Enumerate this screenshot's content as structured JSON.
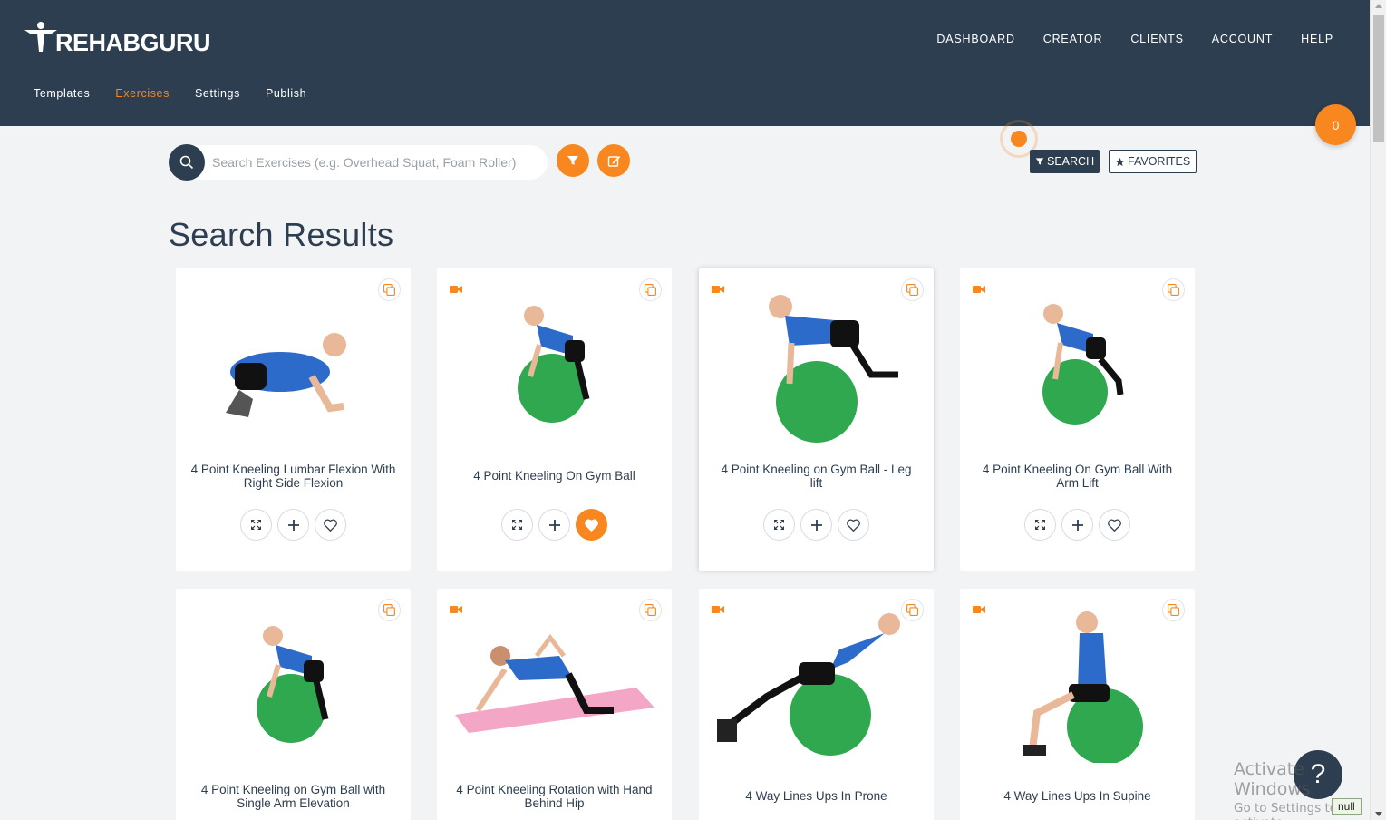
{
  "brand": {
    "name": "REHABGURU",
    "accent": "#f7871e",
    "header_bg": "#2d3e50"
  },
  "topnav": [
    {
      "label": "DASHBOARD"
    },
    {
      "label": "CREATOR"
    },
    {
      "label": "CLIENTS"
    },
    {
      "label": "ACCOUNT"
    },
    {
      "label": "HELP"
    }
  ],
  "subnav": [
    {
      "label": "Templates",
      "active": false
    },
    {
      "label": "Exercises",
      "active": true
    },
    {
      "label": "Settings",
      "active": false
    },
    {
      "label": "Publish",
      "active": false
    }
  ],
  "cart": {
    "count": "0"
  },
  "search": {
    "placeholder": "Search Exercises (e.g. Overhead Squat, Foam Roller)",
    "value": "",
    "search_label": "SEARCH",
    "favorites_label": "FAVORITES"
  },
  "results": {
    "title": "Search Results",
    "cards": [
      {
        "title": "4 Point Kneeling Lumbar Flexion With Right Side Flexion",
        "video": false,
        "favorite": false,
        "icon": "kneeling-person"
      },
      {
        "title": "4 Point Kneeling On Gym Ball",
        "video": true,
        "favorite": true,
        "icon": "gym-ball-kneel"
      },
      {
        "title": "4 Point Kneeling on Gym Ball - Leg lift",
        "video": true,
        "favorite": false,
        "icon": "gym-ball-leg-lift"
      },
      {
        "title": "4 Point Kneeling On Gym Ball With Arm Lift",
        "video": true,
        "favorite": false,
        "icon": "gym-ball-arm-lift"
      },
      {
        "title": "4 Point Kneeling on Gym Ball with Single Arm Elevation",
        "video": false,
        "favorite": false,
        "icon": "gym-ball-kneel"
      },
      {
        "title": "4 Point Kneeling Rotation with Hand Behind Hip",
        "video": true,
        "favorite": false,
        "icon": "mat-rotation"
      },
      {
        "title": "4 Way Lines Ups In Prone",
        "video": true,
        "favorite": false,
        "icon": "gym-ball-prone"
      },
      {
        "title": "4 Way Lines Ups In Supine",
        "video": true,
        "favorite": false,
        "icon": "gym-ball-seated"
      }
    ]
  },
  "help": {
    "label": "?"
  },
  "watermark": {
    "line1": "Activate Windows",
    "line2": "Go to Settings to activate"
  },
  "debug_tag": "null"
}
